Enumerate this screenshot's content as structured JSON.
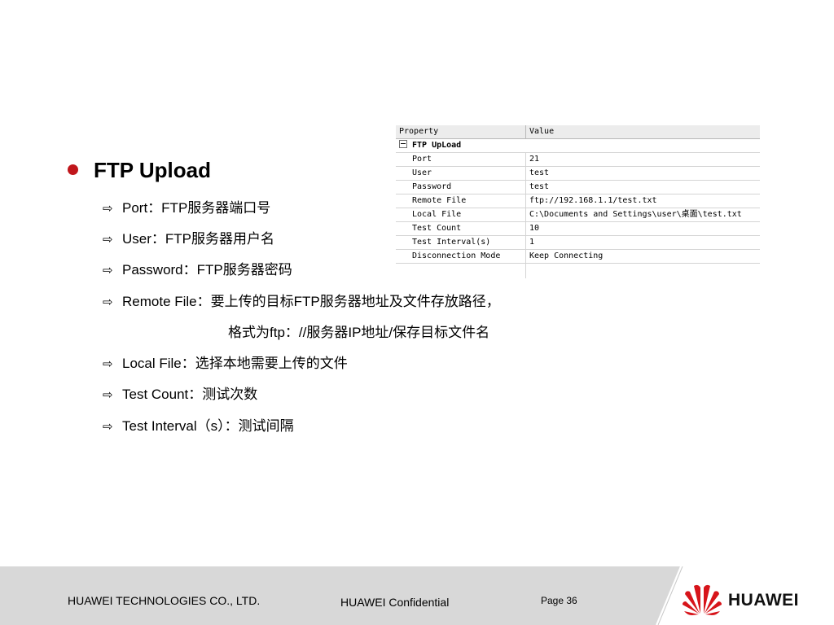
{
  "title": "FTP Upload",
  "items": [
    "Port：FTP服务器端口号",
    "User：FTP服务器用户名",
    "Password：FTP服务器密码",
    "Remote File：要上传的目标FTP服务器地址及文件存放路径，",
    "Local File：选择本地需要上传的文件",
    "Test Count：测试次数",
    "Test Interval（s）：测试间隔"
  ],
  "remote_file_continuation": "格式为ftp：//服务器IP地址/保存目标文件名",
  "property_grid": {
    "header": {
      "property": "Property",
      "value": "Value"
    },
    "group": "FTP UpLoad",
    "rows": [
      {
        "property": "Port",
        "value": "21"
      },
      {
        "property": "User",
        "value": "test"
      },
      {
        "property": "Password",
        "value": "test"
      },
      {
        "property": "Remote File",
        "value": "ftp://192.168.1.1/test.txt"
      },
      {
        "property": "Local File",
        "value": "C:\\Documents and Settings\\user\\桌面\\test.txt"
      },
      {
        "property": "Test Count",
        "value": "10"
      },
      {
        "property": "Test Interval(s)",
        "value": "1"
      },
      {
        "property": "Disconnection Mode",
        "value": "Keep Connecting"
      }
    ]
  },
  "footer": {
    "company": "HUAWEI TECHNOLOGIES CO., LTD.",
    "confidential": "HUAWEI Confidential",
    "page": "Page 36",
    "logo_text": "HUAWEI"
  },
  "colors": {
    "bullet": "#c0161b",
    "logo_red": "#d7141a",
    "footer_bg": "#d8d8d8"
  },
  "icons": {
    "bullet": "filled-circle",
    "sub_bullet": "outline-right-arrow",
    "group_toggle": "collapse-minus-box",
    "logo": "huawei-petals"
  }
}
